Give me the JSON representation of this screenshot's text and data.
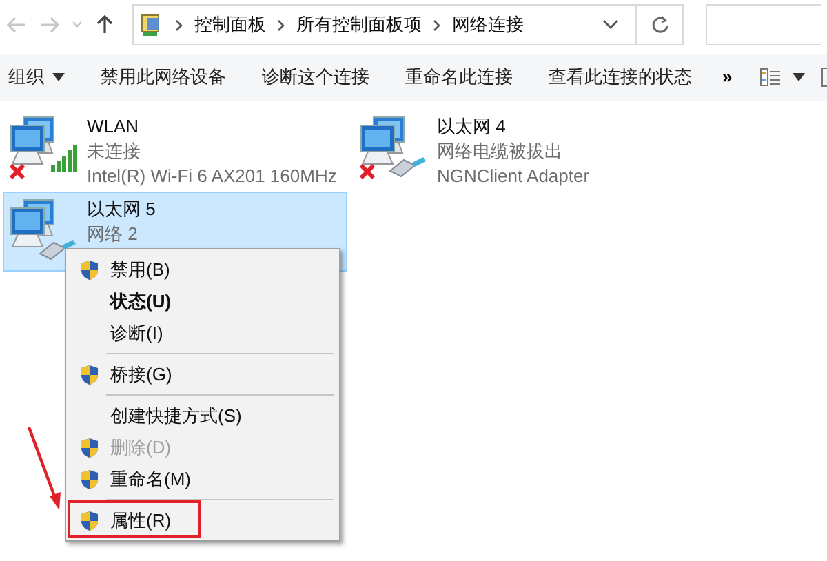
{
  "navigation": {
    "back_disabled": true,
    "forward_disabled": true,
    "up_disabled": false
  },
  "address_bar": {
    "breadcrumbs": [
      "控制面板",
      "所有控制面板项",
      "网络连接"
    ]
  },
  "toolbar": {
    "items": [
      {
        "label": "组织",
        "dropdown": true
      },
      {
        "label": "禁用此网络设备",
        "dropdown": false
      },
      {
        "label": "诊断这个连接",
        "dropdown": false
      },
      {
        "label": "重命名此连接",
        "dropdown": false
      },
      {
        "label": "查看此连接的状态",
        "dropdown": false
      }
    ],
    "overflow": "»"
  },
  "connections": [
    {
      "name": "WLAN",
      "status": "未连接",
      "adapter": "Intel(R) Wi-Fi 6 AX201 160MHz",
      "kind": "wifi",
      "disconnected": true,
      "selected": false
    },
    {
      "name": "以太网 4",
      "status": "网络电缆被拔出",
      "adapter": "NGNClient Adapter",
      "kind": "ethernet",
      "disconnected": true,
      "selected": false
    },
    {
      "name": "以太网 5",
      "status": "网络 2",
      "kind": "ethernet",
      "disconnected": false,
      "selected": true
    }
  ],
  "context_menu": {
    "items": [
      {
        "kind": "item",
        "label": "禁用(B)",
        "shield": true,
        "default": false,
        "disabled": false,
        "callout": false
      },
      {
        "kind": "item",
        "label": "状态(U)",
        "shield": false,
        "default": true,
        "disabled": false,
        "callout": false
      },
      {
        "kind": "item",
        "label": "诊断(I)",
        "shield": false,
        "default": false,
        "disabled": false,
        "callout": false
      },
      {
        "kind": "separator"
      },
      {
        "kind": "item",
        "label": "桥接(G)",
        "shield": true,
        "default": false,
        "disabled": false,
        "callout": false
      },
      {
        "kind": "separator"
      },
      {
        "kind": "item",
        "label": "创建快捷方式(S)",
        "shield": false,
        "default": false,
        "disabled": false,
        "callout": false
      },
      {
        "kind": "item",
        "label": "删除(D)",
        "shield": true,
        "default": false,
        "disabled": true,
        "callout": false
      },
      {
        "kind": "item",
        "label": "重命名(M)",
        "shield": true,
        "default": false,
        "disabled": false,
        "callout": false
      },
      {
        "kind": "separator"
      },
      {
        "kind": "item",
        "label": "属性(R)",
        "shield": true,
        "default": false,
        "disabled": false,
        "callout": true
      }
    ]
  }
}
